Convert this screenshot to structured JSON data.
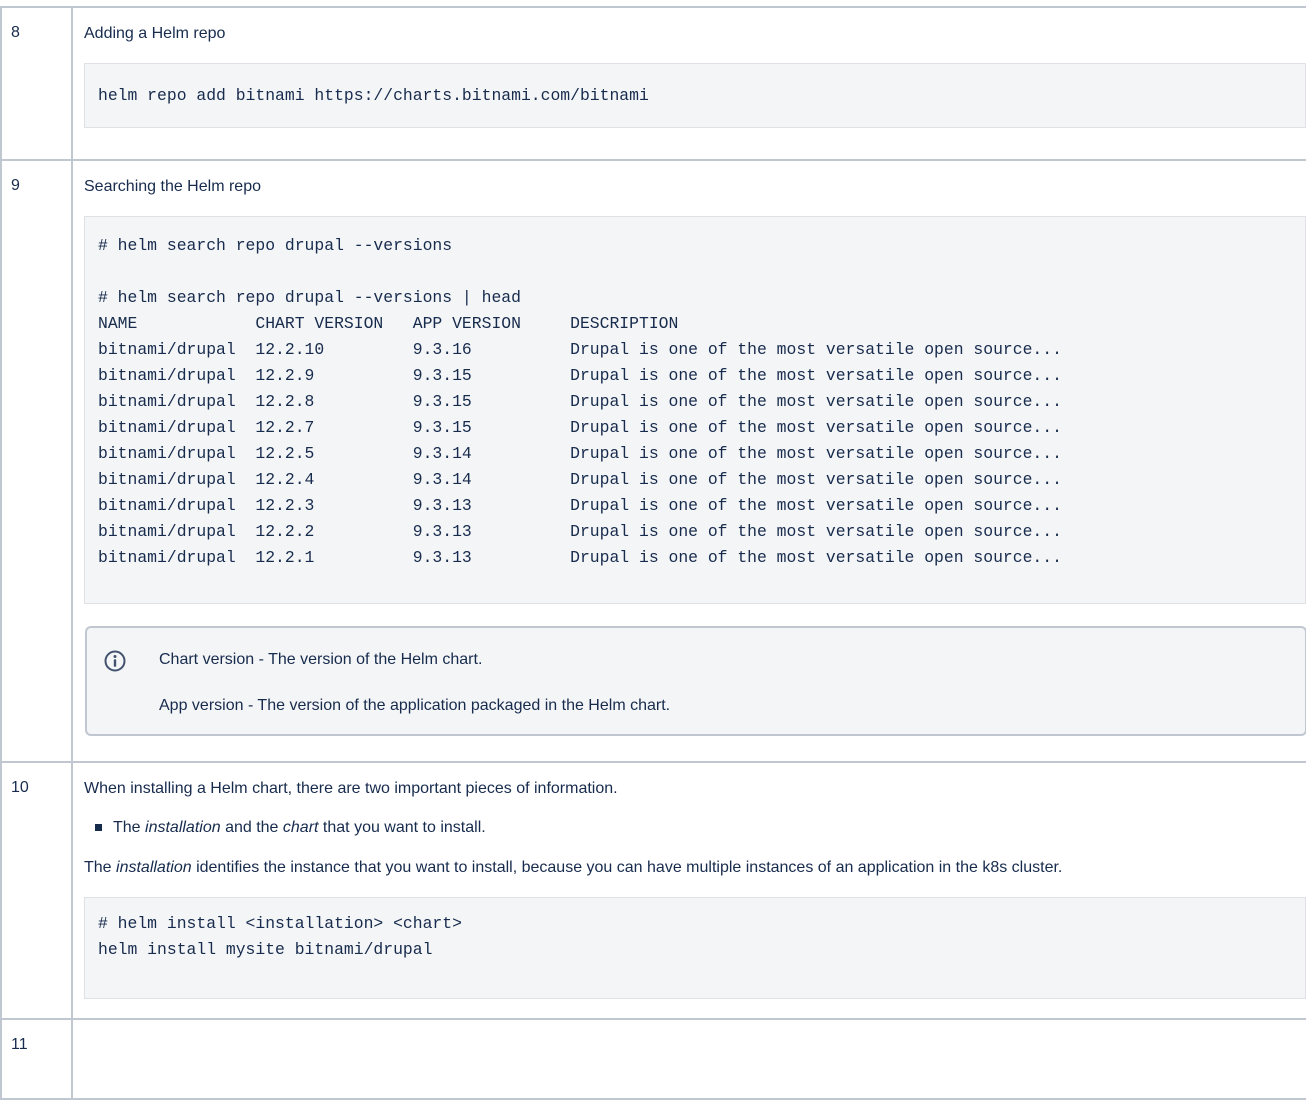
{
  "steps": [
    {
      "number": "8",
      "title": "Adding a Helm repo",
      "code": "helm repo add bitnami https://charts.bitnami.com/bitnami"
    },
    {
      "number": "9",
      "title": "Searching the Helm repo",
      "code": "# helm search repo drupal --versions\n\n# helm search repo drupal --versions | head\nNAME            CHART VERSION   APP VERSION     DESCRIPTION\nbitnami/drupal  12.2.10         9.3.16          Drupal is one of the most versatile open source...\nbitnami/drupal  12.2.9          9.3.15          Drupal is one of the most versatile open source...\nbitnami/drupal  12.2.8          9.3.15          Drupal is one of the most versatile open source...\nbitnami/drupal  12.2.7          9.3.15          Drupal is one of the most versatile open source...\nbitnami/drupal  12.2.5          9.3.14          Drupal is one of the most versatile open source...\nbitnami/drupal  12.2.4          9.3.14          Drupal is one of the most versatile open source...\nbitnami/drupal  12.2.3          9.3.13          Drupal is one of the most versatile open source...\nbitnami/drupal  12.2.2          9.3.13          Drupal is one of the most versatile open source...\nbitnami/drupal  12.2.1          9.3.13          Drupal is one of the most versatile open source...",
      "info": {
        "icon": "info-icon",
        "line1": "Chart version - The version of the Helm chart.",
        "line2": "App version - The version of the application packaged in the Helm chart."
      }
    },
    {
      "number": "10",
      "intro": "When installing a Helm chart, there are two important pieces of information.",
      "bullet": {
        "pre": "The ",
        "em1": "installation",
        "mid": " and the ",
        "em2": "chart",
        "post": " that you want to install."
      },
      "para": {
        "pre": "The ",
        "em": "installation",
        "post": " identifies the instance that you want to install, because you can have multiple instances of an application in the k8s cluster."
      },
      "code": "# helm install <installation> <chart>\nhelm install mysite bitnami/drupal"
    },
    {
      "number": "11"
    }
  ],
  "colors": {
    "border": "#c1c7d0",
    "code_bg": "#f4f5f7",
    "text": "#172b4d",
    "info_icon": "#42526e"
  }
}
